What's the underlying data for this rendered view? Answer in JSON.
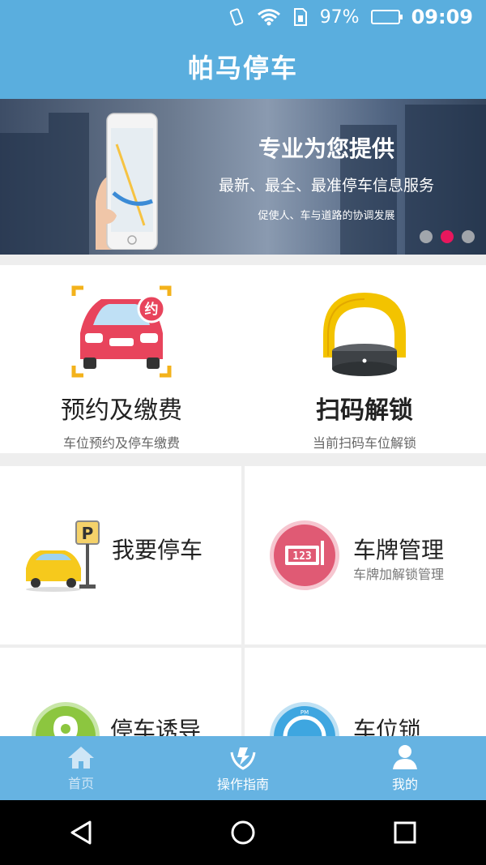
{
  "status_bar": {
    "battery": "97%",
    "time": "09:09"
  },
  "app_bar": {
    "title": "帕马停车"
  },
  "banner": {
    "slogan_main": "专业为您提供",
    "slogan_secondary": "最新、最全、最准停车信息服务",
    "slogan_tertiary": "促使人、车与道路的协调发展",
    "active_slide": 2,
    "slide_count": 3
  },
  "features": [
    {
      "title": "预约及缴费",
      "subtitle": "车位预约及停车缴费",
      "badge": "约",
      "icon": "reserved-car-icon"
    },
    {
      "title": "扫码解锁",
      "subtitle": "当前扫码车位解锁",
      "icon": "parking-lock-icon"
    }
  ],
  "tiles": [
    {
      "title": "我要停车",
      "subtitle": "",
      "icon": "car-parking-sign-icon"
    },
    {
      "title": "车牌管理",
      "subtitle": "车牌加解锁管理",
      "icon": "license-plate-icon"
    },
    {
      "title": "停车诱导",
      "subtitle": "",
      "icon": "location-pin-icon"
    },
    {
      "title": "车位锁",
      "subtitle": "",
      "icon": "parking-lock-gauge-icon"
    }
  ],
  "bottom_nav": [
    {
      "label": "首页",
      "icon": "home-icon"
    },
    {
      "label": "操作指南",
      "icon": "guide-hands-icon"
    },
    {
      "label": "我的",
      "icon": "user-icon"
    }
  ],
  "colors": {
    "primary": "#5aaede",
    "bottom_nav": "#66b3e2",
    "accent_dot": "#e8175d",
    "plate_circle": "#e05a74",
    "lock_yellow": "#f3c300",
    "car_red": "#e8445c"
  }
}
